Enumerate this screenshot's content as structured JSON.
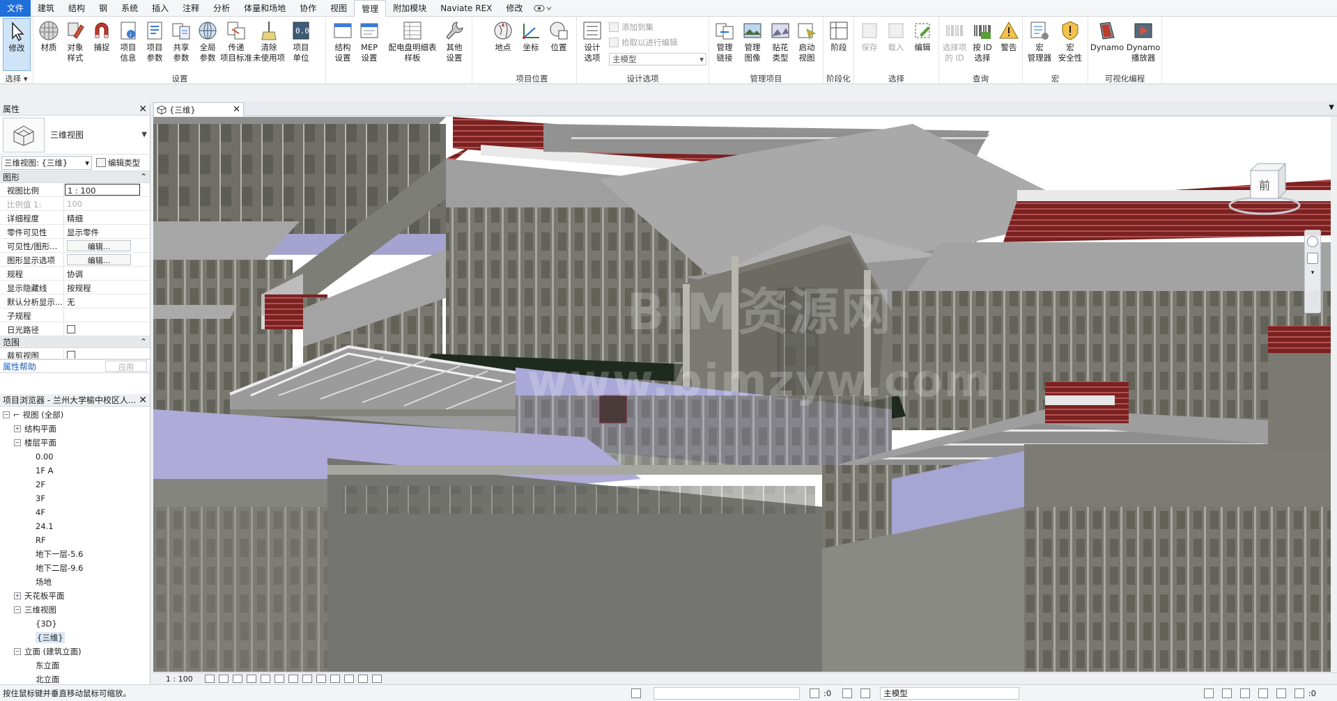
{
  "menubar": {
    "file": "文件",
    "tabs": [
      "建筑",
      "结构",
      "钢",
      "系统",
      "插入",
      "注释",
      "分析",
      "体量和场地",
      "协作",
      "视图",
      "管理",
      "附加模块",
      "Naviate REX",
      "修改"
    ],
    "active_tab": "管理"
  },
  "ribbon": {
    "select_label": "选择",
    "modify": "修改",
    "settings_group": "设置",
    "settings": [
      "材质",
      "对象\n样式",
      "捕捉",
      "项目\n信息",
      "项目\n参数",
      "共享\n参数",
      "全局\n参数",
      "传递\n项目标准",
      "清除\n未使用项",
      "项目\n单位"
    ],
    "settings2": [
      "结构\n设置",
      "MEP\n设置",
      "配电盘明细表\n样板",
      "其他\n设置"
    ],
    "location_group": "项目位置",
    "location": [
      "地点",
      "坐标",
      "位置"
    ],
    "design_options_group": "设计选项",
    "design_options": "设计\n选项",
    "add_to_set": "添加到集",
    "pick_to_edit": "拾取以进行编辑",
    "main_model": "主模型",
    "manage_project_group": "管理项目",
    "manage_project": [
      "管理\n链接",
      "管理\n图像",
      "贴花\n类型",
      "启动\n视图"
    ],
    "phasing_group": "阶段化",
    "phasing": "阶段",
    "selection_group": "选择",
    "selection": [
      "保存",
      "载入",
      "编辑"
    ],
    "inquiry_group": "查询",
    "inquiry": [
      "选择项\n的 ID",
      "按 ID\n选择",
      "警告"
    ],
    "macros_group": "宏",
    "macros": [
      "宏\n管理器",
      "宏\n安全性"
    ],
    "visual_group": "可视化编程",
    "visual": [
      "Dynamo",
      "Dynamo\n播放器"
    ]
  },
  "properties": {
    "title": "属性",
    "type_name": "三维视图",
    "view_selector": "三维视图: {三维}",
    "edit_type": "编辑类型",
    "section_graphics": "图形",
    "rows": [
      {
        "k": "视图比例",
        "v": "1 : 100"
      },
      {
        "k": "比例值 1:",
        "v": "100"
      },
      {
        "k": "详细程度",
        "v": "精细"
      },
      {
        "k": "零件可见性",
        "v": "显示零件"
      },
      {
        "k": "可见性/图形...",
        "v": "编辑..."
      },
      {
        "k": "图形显示选项",
        "v": "编辑..."
      },
      {
        "k": "规程",
        "v": "协调"
      },
      {
        "k": "显示隐藏线",
        "v": "按规程"
      },
      {
        "k": "默认分析显示...",
        "v": "无"
      },
      {
        "k": "子规程",
        "v": ""
      },
      {
        "k": "日光路径",
        "v": ""
      }
    ],
    "section_extents": "范围",
    "crop_view": "裁剪视图",
    "help": "属性帮助",
    "apply": "应用"
  },
  "browser": {
    "title": "项目浏览器 - 兰州大学榆中校区人...",
    "nodes": [
      {
        "label": "视图 (全部)",
        "level": 0,
        "toggle": "−"
      },
      {
        "label": "结构平面",
        "level": 1,
        "toggle": "+"
      },
      {
        "label": "楼层平面",
        "level": 1,
        "toggle": "−"
      },
      {
        "label": "0.00",
        "level": 2,
        "toggle": ""
      },
      {
        "label": "1F  A",
        "level": 2,
        "toggle": ""
      },
      {
        "label": "2F",
        "level": 2,
        "toggle": ""
      },
      {
        "label": "3F",
        "level": 2,
        "toggle": ""
      },
      {
        "label": "4F",
        "level": 2,
        "toggle": ""
      },
      {
        "label": "24.1",
        "level": 2,
        "toggle": ""
      },
      {
        "label": "RF",
        "level": 2,
        "toggle": ""
      },
      {
        "label": "地下一层-5.6",
        "level": 2,
        "toggle": ""
      },
      {
        "label": "地下二层-9.6",
        "level": 2,
        "toggle": ""
      },
      {
        "label": "场地",
        "level": 2,
        "toggle": ""
      },
      {
        "label": "天花板平面",
        "level": 1,
        "toggle": "+"
      },
      {
        "label": "三维视图",
        "level": 1,
        "toggle": "−"
      },
      {
        "label": "{3D}",
        "level": 2,
        "toggle": ""
      },
      {
        "label": "{三维}",
        "level": 2,
        "toggle": ""
      },
      {
        "label": "立面 (建筑立面)",
        "level": 1,
        "toggle": "−"
      },
      {
        "label": "东立面",
        "level": 2,
        "toggle": ""
      },
      {
        "label": "北立面",
        "level": 2,
        "toggle": ""
      }
    ]
  },
  "view": {
    "tab_title": "{三维}",
    "scale": "1 : 100",
    "viewcube_face": "前",
    "watermark_line1": "BIM资源网",
    "watermark_line2": "www.bimzyw.com"
  },
  "status": {
    "message": "按住鼠标键并垂直移动鼠标可缩放。",
    "count": ":0",
    "model": "主模型",
    "filter_count": ":0"
  },
  "colors": {
    "accent": "#1e6fd9",
    "roof": "#a2a2a2",
    "wall": "#7c7c74",
    "floor": "#9a98c8",
    "red_trim": "#8b2a2a"
  }
}
